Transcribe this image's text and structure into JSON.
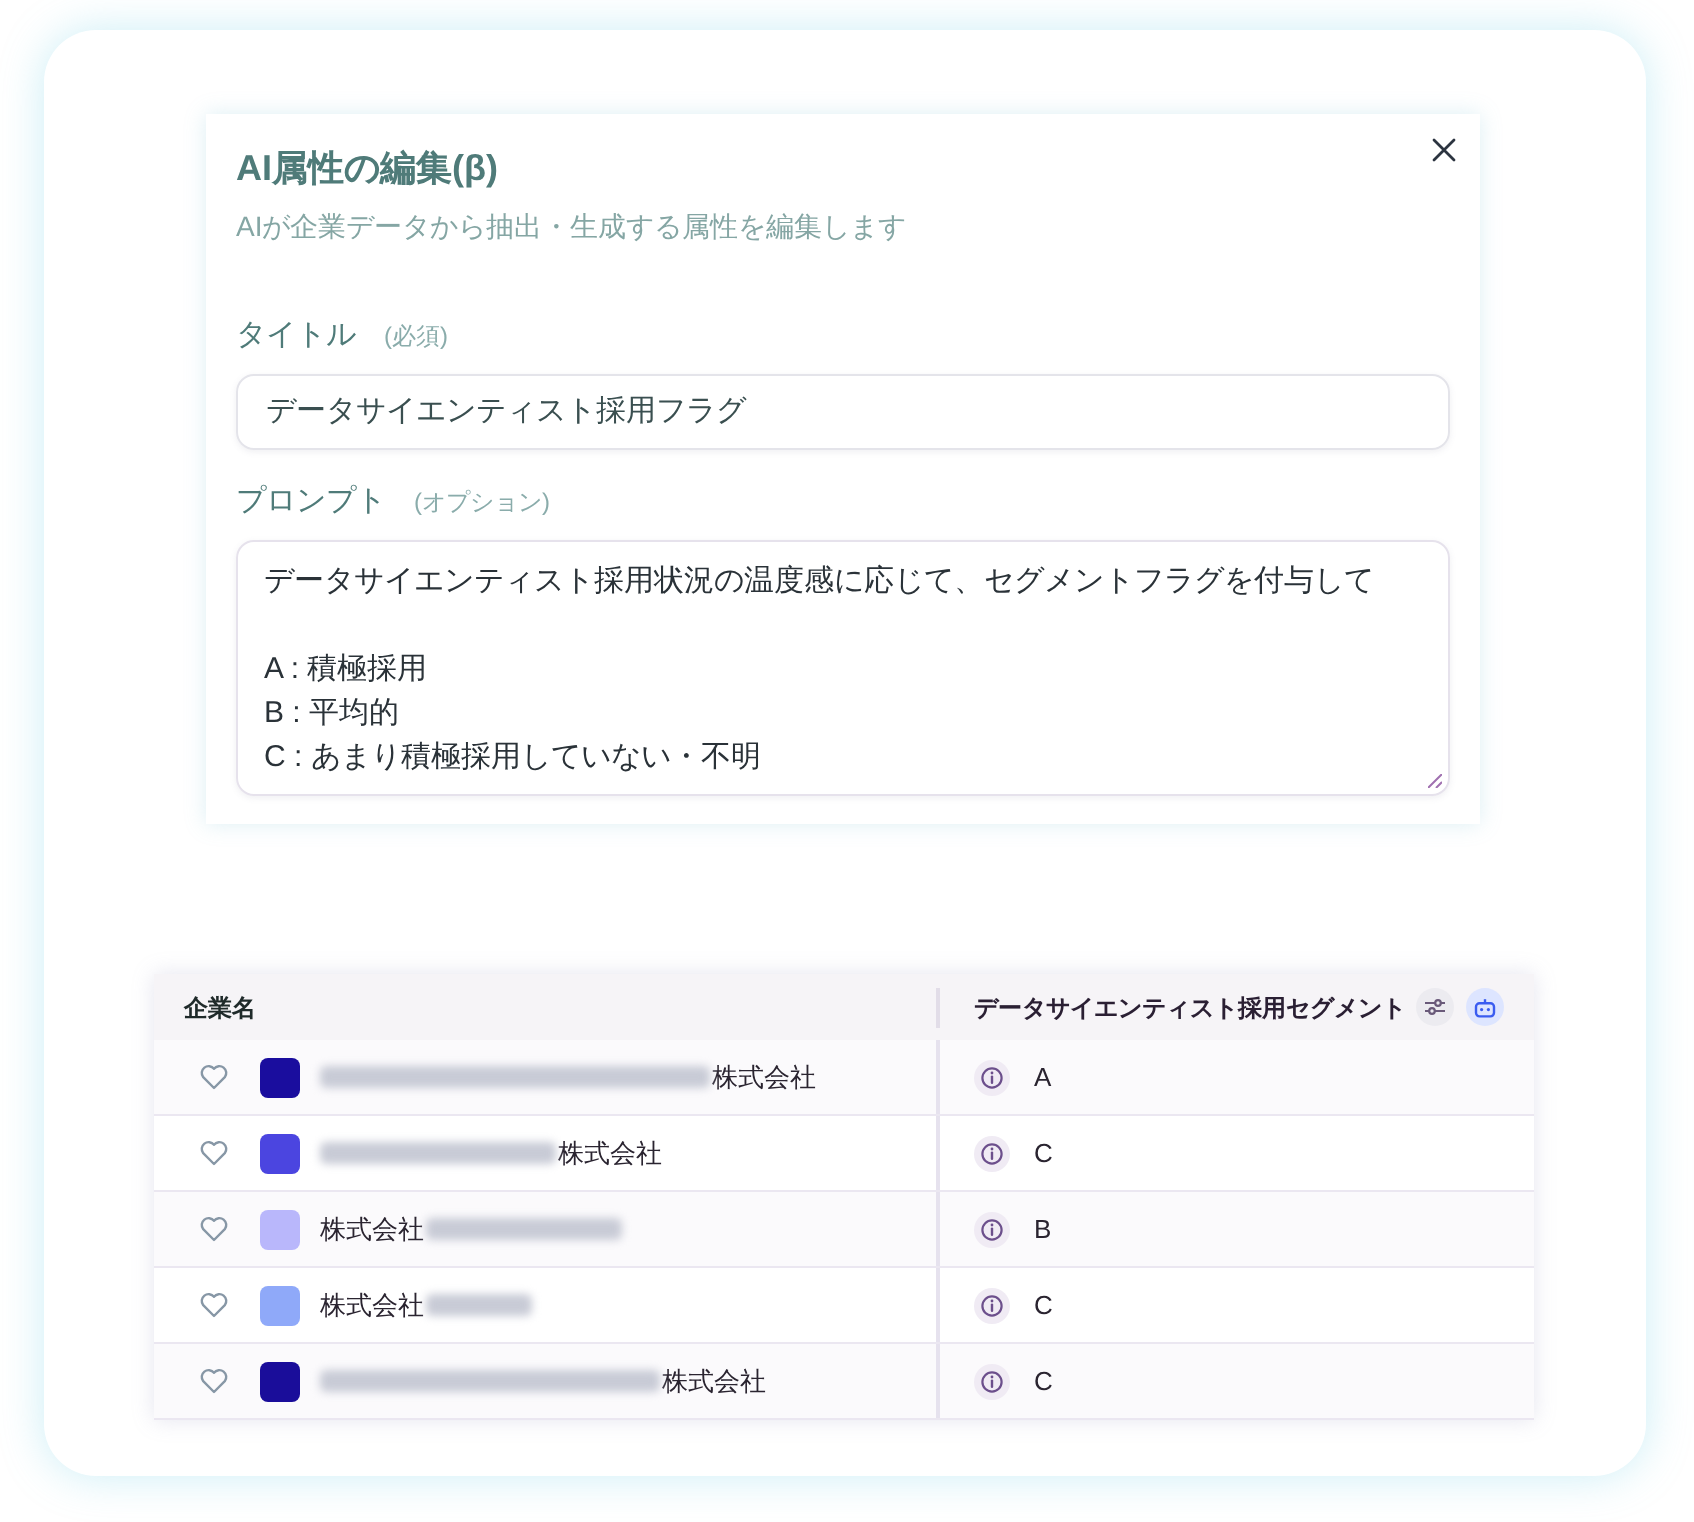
{
  "dialog": {
    "title": "AI属性の編集(β)",
    "subtitle": "AIが企業データから抽出・生成する属性を編集します",
    "fields": [
      {
        "kind": "input",
        "label": "タイトル",
        "hint": "(必須)",
        "value": "データサイエンティスト採用フラグ"
      },
      {
        "kind": "textarea",
        "label": "プロンプト",
        "hint": "(オプション)",
        "value": "データサイエンティスト採用状況の温度感に応じて、セグメントフラグを付与して\n\nA : 積極採用\nB : 平均的\nC : あまり積極採用していない・不明"
      }
    ]
  },
  "table": {
    "columns": [
      "企業名",
      "データサイエンティスト採用セグメント"
    ],
    "rows": [
      {
        "favorite": false,
        "color": "#1a0d9e",
        "name_parts": [
          {
            "kind": "blurred"
          },
          {
            "kind": "text",
            "text": "株式会社"
          }
        ],
        "segment": "A"
      },
      {
        "favorite": false,
        "color": "#4b45e0",
        "name_parts": [
          {
            "kind": "blurred"
          },
          {
            "kind": "text",
            "text": "株式会社"
          }
        ],
        "segment": "C"
      },
      {
        "favorite": false,
        "color": "#b9b7fb",
        "name_parts": [
          {
            "kind": "text",
            "text": "株式会社"
          },
          {
            "kind": "blurred"
          }
        ],
        "segment": "B"
      },
      {
        "favorite": false,
        "color": "#8fa9f9",
        "name_parts": [
          {
            "kind": "text",
            "text": "株式会社"
          },
          {
            "kind": "blurred"
          }
        ],
        "segment": "C"
      },
      {
        "favorite": false,
        "color": "#1a0d9a",
        "name_parts": [
          {
            "kind": "blurred"
          },
          {
            "kind": "text",
            "text": "株式会社"
          }
        ],
        "segment": "C"
      }
    ]
  }
}
